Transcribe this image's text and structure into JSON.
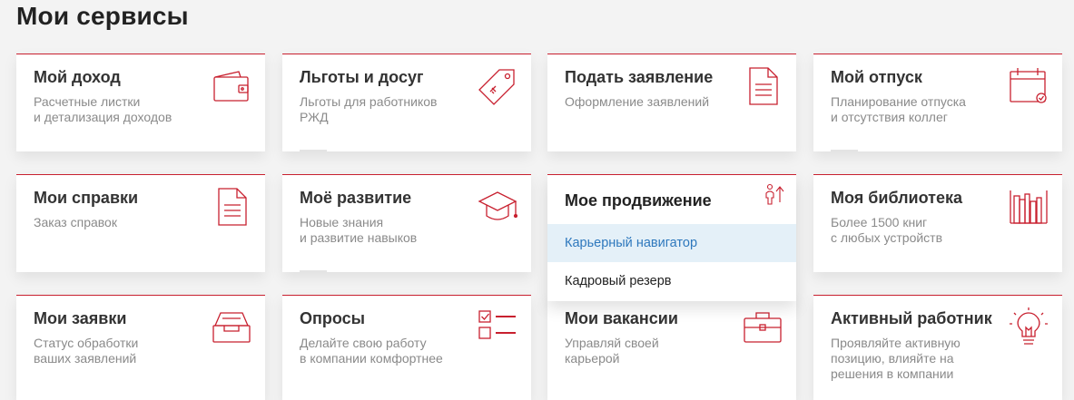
{
  "page": {
    "title": "Мои сервисы"
  },
  "colors": {
    "accent": "#c8202f",
    "link": "#2e78bd",
    "highlight_bg": "#e4f0f8"
  },
  "cards": [
    {
      "title": "Мой доход",
      "desc1": "Расчетные листки",
      "desc2": "и детализация доходов",
      "icon": "wallet-icon"
    },
    {
      "title": "Льготы и досуг",
      "desc1": "Льготы для работников",
      "desc2": "РЖД",
      "icon": "price-tag-icon"
    },
    {
      "title": "Подать заявление",
      "desc1": "Оформление заявлений",
      "desc2": "",
      "icon": "document-icon"
    },
    {
      "title": "Мой отпуск",
      "desc1": "Планирование отпуска",
      "desc2": "и отсутствия коллег",
      "icon": "calendar-check-icon"
    },
    {
      "title": "Мои справки",
      "desc1": "Заказ справок",
      "desc2": "",
      "icon": "document-icon"
    },
    {
      "title": "Моё развитие",
      "desc1": "Новые знания",
      "desc2": "и развитие навыков",
      "icon": "graduation-cap-icon"
    },
    {
      "title": "Мое продвижение",
      "icon": "career-growth-icon",
      "menu": [
        "Карьерный навигатор",
        "Кадровый резерв"
      ]
    },
    {
      "title": "Моя библиотека",
      "desc1": "Более 1500 книг",
      "desc2": "с любых устройств",
      "icon": "bookshelf-icon"
    },
    {
      "title": "Мои заявки",
      "desc1": "Статус обработки",
      "desc2": "ваших заявлений",
      "icon": "inbox-tray-icon"
    },
    {
      "title": "Опросы",
      "desc1": "Делайте свою работу",
      "desc2": "в компании комфортнее",
      "icon": "checklist-icon"
    },
    {
      "title": "Мои вакансии",
      "desc1": "Управляй своей",
      "desc2": "карьерой",
      "icon": "briefcase-icon"
    },
    {
      "title": "Активный работник",
      "desc1": "Проявляйте активную",
      "desc2": "позицию, влияйте на",
      "desc3": "решения в компании",
      "icon": "lightbulb-icon"
    }
  ]
}
